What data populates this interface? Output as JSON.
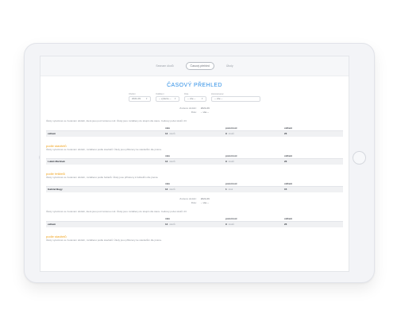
{
  "nav": {
    "items": [
      {
        "label": "Seznam úkolů",
        "active": false
      },
      {
        "label": "Časový přehled",
        "active": true
      },
      {
        "label": "Úkoly",
        "active": false
      }
    ]
  },
  "page": {
    "title": "ČASOVÝ PŘEHLED"
  },
  "filters": [
    {
      "label": "Období",
      "value": "2021-09"
    },
    {
      "label": "Oddělení",
      "value": "-- vyberte --"
    },
    {
      "label": "Role",
      "value": "-- vše --"
    },
    {
      "label": "Zaměstnanec",
      "value": "-- vše --"
    }
  ],
  "summaries": [
    {
      "period_label": "Zvolené období:",
      "period_value": "2021-09",
      "role_label": "Role:",
      "role_value": "-- vše --",
      "note": "Úkoly vytvořené ve zvoleném období, které jsou pod zvolenou rolí. Úkoly jsou rozděleny do skupin dle stavu. Celkový počet úkolů: 23",
      "columns": [
        "",
        "stav",
        "pozornost",
        "celkem"
      ],
      "row": {
        "name": "celkem",
        "stav": "14",
        "stav_unit": "úkolů",
        "pozornost": "9",
        "pozornost_unit": "úkolů",
        "celkem": "23"
      }
    },
    {
      "period_label": "Zvolené období:",
      "period_value": "2021-09",
      "role_label": "Role:",
      "role_value": "-- vše --",
      "note": "Úkoly vytvořené ve zvoleném období, které jsou pod zvolenou rolí. Úkoly jsou rozděleny do skupin dle stavu. Celkový počet úkolů: 23",
      "columns": [
        "",
        "stav",
        "pozornost",
        "celkem"
      ],
      "row": {
        "name": "celkem",
        "stav": "14",
        "stav_unit": "úkolů",
        "pozornost": "9",
        "pozornost_unit": "úkolů",
        "celkem": "23"
      }
    }
  ],
  "sections": [
    {
      "title": "podle stavitelů",
      "note": "Úkoly vytvořené ve zvoleném období, rozdělené podle stavitelů. Úkoly jsou přiřazeny ke stavitelům dle jména.",
      "columns": [
        "",
        "stav",
        "pozornost",
        "celkem"
      ],
      "row": {
        "name": "Lukáš Martinek",
        "stav": "14",
        "stav_unit": "úkolů",
        "pozornost": "9",
        "pozornost_unit": "úkolů",
        "celkem": "23"
      }
    },
    {
      "title": "podle řešitelů",
      "note": "Úkoly vytvořené ve zvoleném období, rozdělené podle řešitelů. Úkoly jsou přiřazeny k řešitelům dle jména.",
      "columns": [
        "",
        "stav",
        "pozornost",
        "celkem"
      ],
      "row": {
        "name": "Gabriel Bugy",
        "stav": "14",
        "stav_unit": "úkolů",
        "pozornost": "1",
        "pozornost_unit": "úkol",
        "celkem": "15"
      }
    },
    {
      "title": "podle stavitelů",
      "note": "Úkoly vytvořené ve zvoleném období, rozdělené podle stavitelů. Úkoly jsou přiřazeny ke stavitelům dle jména.",
      "columns": [],
      "row": null
    }
  ],
  "colors": {
    "accent": "#2f8fe6",
    "section_title": "#f0a21a",
    "row_bg": "#f0f1f3"
  }
}
